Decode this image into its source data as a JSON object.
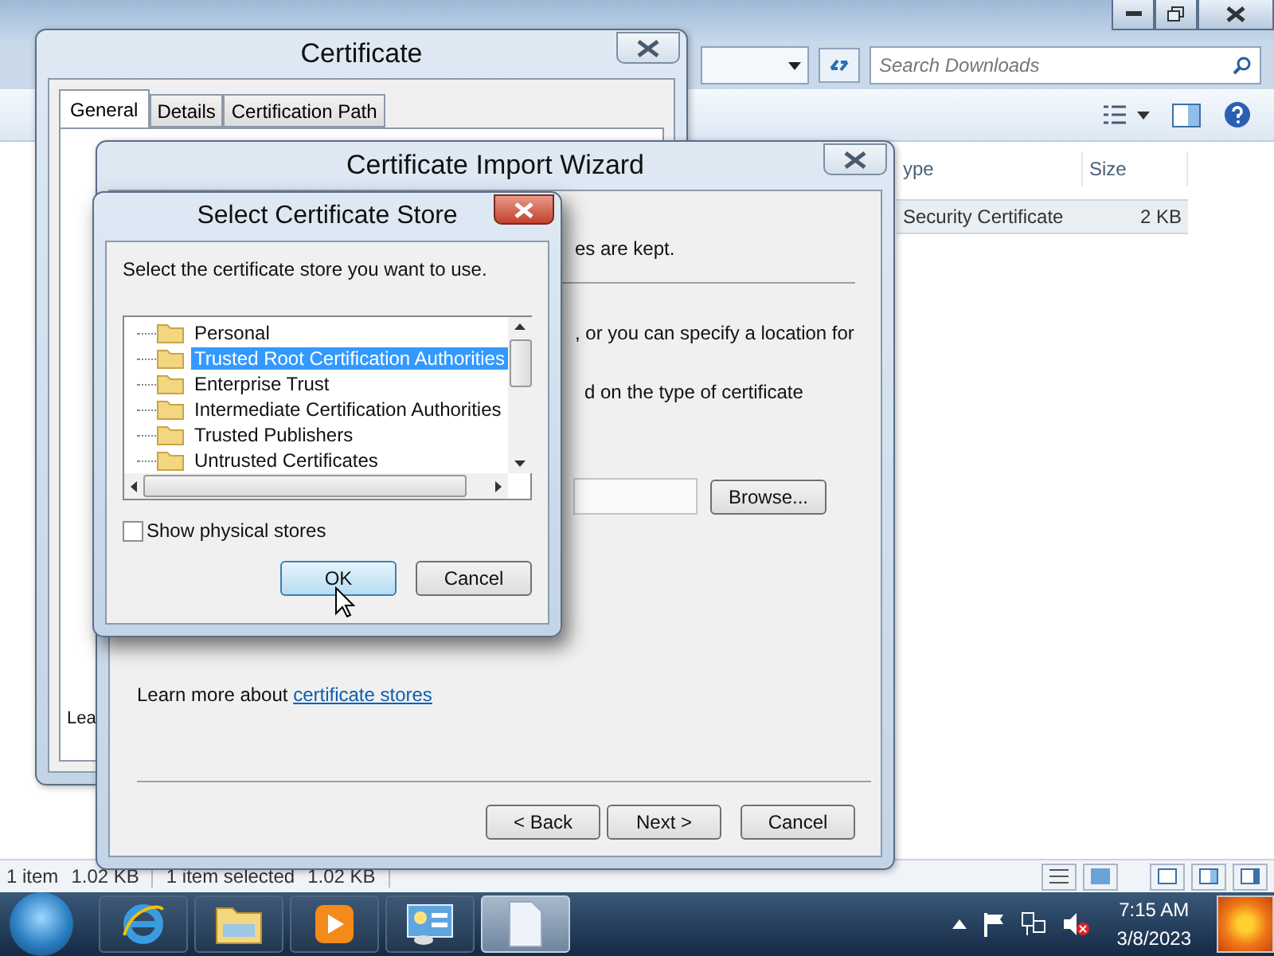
{
  "explorer": {
    "search": {
      "placeholder": "Search Downloads"
    },
    "columns": [
      "ype",
      "Size"
    ],
    "rows": [
      {
        "type": "Security Certificate",
        "size": "2 KB",
        "selected": true
      }
    ],
    "status": [
      "1 item",
      "1.02 KB",
      "1 item selected",
      "1.02 KB"
    ]
  },
  "certificate_window": {
    "title": "Certificate",
    "tabs": [
      {
        "label": "General",
        "selected": true
      },
      {
        "label": "Details",
        "selected": false
      },
      {
        "label": "Certification Path",
        "selected": false
      }
    ],
    "footer_text": "Lea"
  },
  "import_wizard": {
    "title": "Certificate Import Wizard",
    "text_fragments": [
      "es are kept.",
      ", or you can specify a location for",
      "d on the type of certificate"
    ],
    "browse_button": "Browse...",
    "learn_more": {
      "text": "Learn more about ",
      "link": "certificate stores"
    },
    "buttons": [
      "< Back",
      "Next >",
      "Cancel"
    ]
  },
  "store_dialog": {
    "title": "Select Certificate Store",
    "prompt": "Select the certificate store you want to use.",
    "stores": [
      {
        "label": "Personal",
        "selected": false
      },
      {
        "label": "Trusted Root Certification Authorities",
        "selected": true
      },
      {
        "label": "Enterprise Trust",
        "selected": false
      },
      {
        "label": "Intermediate Certification Authorities",
        "selected": false
      },
      {
        "label": "Trusted Publishers",
        "selected": false
      },
      {
        "label": "Untrusted Certificates",
        "selected": false
      }
    ],
    "show_physical": {
      "label": "Show physical stores",
      "checked": false
    },
    "buttons": [
      {
        "label": "OK",
        "focused": true
      },
      {
        "label": "Cancel",
        "focused": false
      }
    ]
  },
  "taskbar": {
    "apps": [
      {
        "kind": "browser",
        "active": false
      },
      {
        "kind": "folder",
        "active": false
      },
      {
        "kind": "media",
        "active": false
      },
      {
        "kind": "panel",
        "active": false
      },
      {
        "kind": "document",
        "active": true
      }
    ],
    "time": "7:15 AM",
    "date": "3/8/2023"
  }
}
